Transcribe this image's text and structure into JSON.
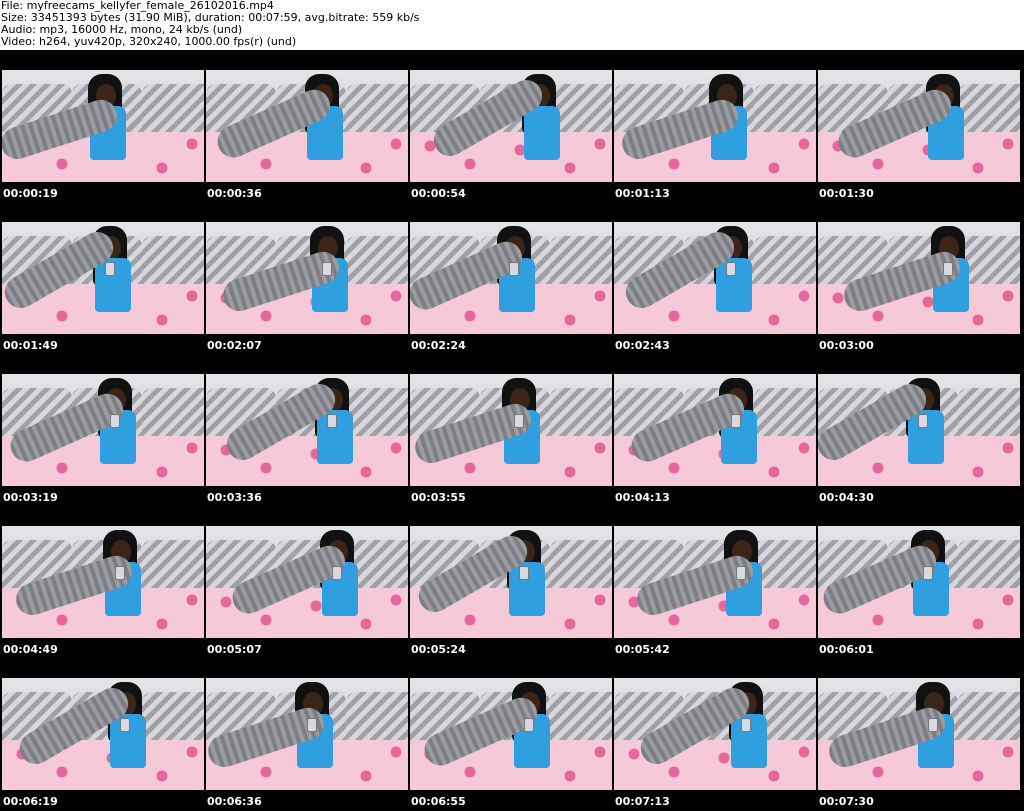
{
  "header": {
    "file_line": "File: myfreecams_kellyfer_female_26102016.mp4",
    "size_line": "Size: 33451393 bytes (31.90 MiB), duration: 00:07:59, avg.bitrate: 559 kb/s",
    "audio_line": "Audio: mp3, 16000 Hz, mono, 24 kb/s (und)",
    "video_line": "Video: h264, yuv420p, 320x240, 1000.00 fps(r) (und)"
  },
  "colors": {
    "background": "#000000",
    "header_background": "#ffffff",
    "timestamp_text": "#ffffff",
    "top_color": "#2f9fe0",
    "stocking_color": "#8a8b91",
    "bedding_color": "#f6c9d9"
  },
  "thumbnails": [
    {
      "time": "00:00:19"
    },
    {
      "time": "00:00:36"
    },
    {
      "time": "00:00:54"
    },
    {
      "time": "00:01:13"
    },
    {
      "time": "00:01:30"
    },
    {
      "time": "00:01:49"
    },
    {
      "time": "00:02:07"
    },
    {
      "time": "00:02:24"
    },
    {
      "time": "00:02:43"
    },
    {
      "time": "00:03:00"
    },
    {
      "time": "00:03:19"
    },
    {
      "time": "00:03:36"
    },
    {
      "time": "00:03:55"
    },
    {
      "time": "00:04:13"
    },
    {
      "time": "00:04:30"
    },
    {
      "time": "00:04:49"
    },
    {
      "time": "00:05:07"
    },
    {
      "time": "00:05:24"
    },
    {
      "time": "00:05:42"
    },
    {
      "time": "00:06:01"
    },
    {
      "time": "00:06:19"
    },
    {
      "time": "00:06:36"
    },
    {
      "time": "00:06:55"
    },
    {
      "time": "00:07:13"
    },
    {
      "time": "00:07:30"
    }
  ]
}
